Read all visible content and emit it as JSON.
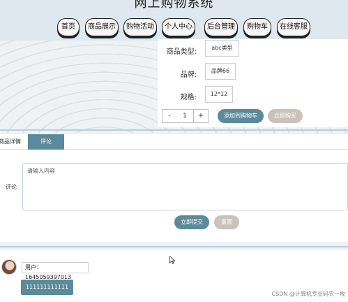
{
  "header": {
    "title": "网上购物系统",
    "nav": [
      "首页",
      "商品展示",
      "购物活动",
      "个人中心",
      "后台管理",
      "购物车",
      "在线客服"
    ]
  },
  "product": {
    "attributes": [
      {
        "label": "商品类型:",
        "value": "abc类型"
      },
      {
        "label": "品牌:",
        "value": "品牌66"
      },
      {
        "label": "规格:",
        "value": "12*12"
      }
    ],
    "quantity": {
      "minus": "-",
      "value": "1",
      "plus": "+"
    },
    "add_to_cart": "添加到购物车",
    "buy_now": "立即购买"
  },
  "tabs": {
    "details": "商品详情",
    "comments": "评论"
  },
  "comment_form": {
    "label": "评论",
    "placeholder": "请输入内容",
    "submit": "立即提交",
    "reset": "重置"
  },
  "comments": [
    {
      "user": "用户：1645059397013",
      "content": "111111111111"
    }
  ],
  "watermark": "CSDN @计算机专业码农一枚",
  "colors": {
    "accent": "#5b8a9a",
    "secondary_button": "#c9c3bb",
    "header_bg": "#dfe8ee"
  }
}
